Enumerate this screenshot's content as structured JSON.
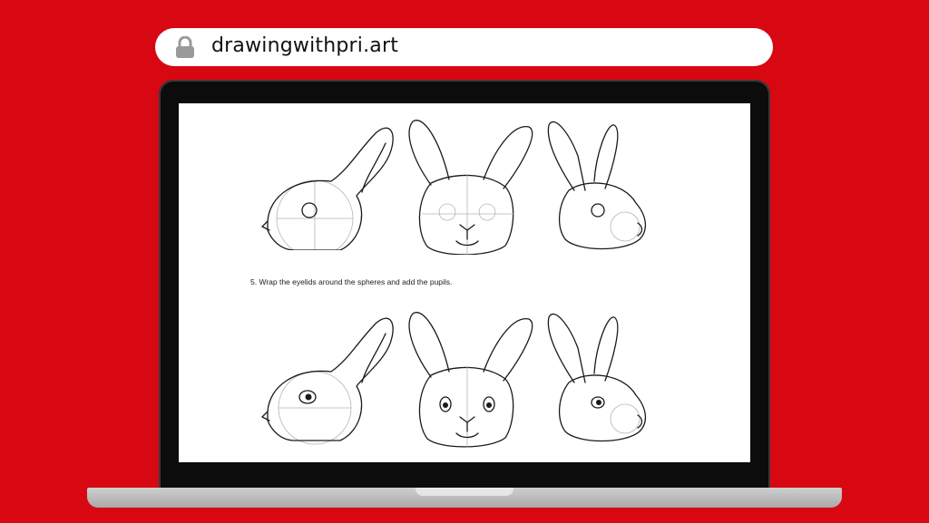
{
  "browser": {
    "url": "drawingwithpri.art",
    "lock_icon": "lock-icon"
  },
  "page": {
    "instruction": "5. Wrap the eyelids around the spheres and add the pupils."
  },
  "colors": {
    "background": "#d70812",
    "bezel": "#0c0c0c",
    "base": "#b8b8b8"
  }
}
